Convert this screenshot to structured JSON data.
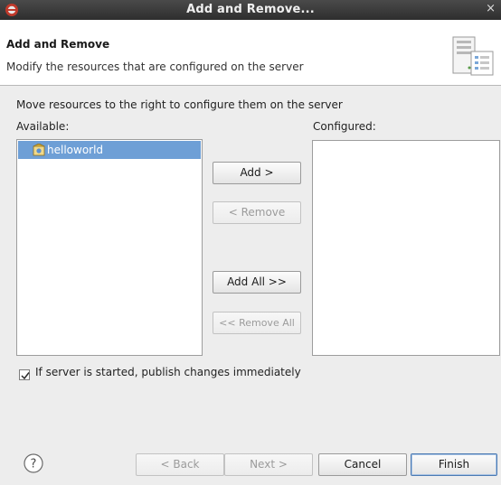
{
  "window": {
    "title": "Add and Remove...",
    "close_glyph": "×",
    "app_icon": "eclipse-icon"
  },
  "header": {
    "title": "Add and Remove",
    "description": "Modify the resources that are configured on the server",
    "banner_icon": "server-wizard-icon"
  },
  "content": {
    "instruction": "Move resources to the right to configure them on the server",
    "available_label": "Available:",
    "configured_label": "Configured:",
    "available_items": [
      {
        "label": "helloworld",
        "icon": "web-project-icon",
        "selected": true
      }
    ],
    "configured_items": []
  },
  "buttons": {
    "add": "Add >",
    "remove": "< Remove",
    "add_all": "Add All >>",
    "remove_all": "<< Remove All"
  },
  "publish_option": {
    "label": "If server is started, publish changes immediately",
    "checked": true
  },
  "footer": {
    "help_icon": "help-icon",
    "back": "< Back",
    "next": "Next >",
    "cancel": "Cancel",
    "finish": "Finish"
  },
  "colors": {
    "titlebar": "#3a3a3a",
    "selection": "#6e9fd6",
    "background": "#ededed"
  }
}
